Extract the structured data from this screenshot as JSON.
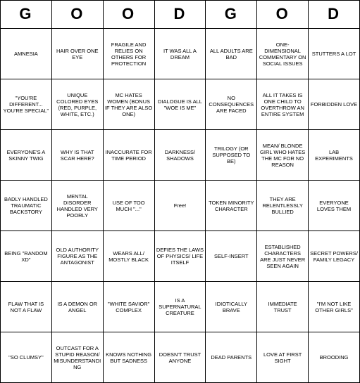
{
  "header": {
    "cols": [
      "G",
      "O",
      "O",
      "D",
      "G",
      "O",
      "D"
    ]
  },
  "rows": [
    [
      "AMNESIA",
      "HAIR OVER ONE EYE",
      "FRAGILE AND RELIES ON OTHERS FOR PROTECTION",
      "IT WAS ALL A DREAM",
      "ALL ADULTS ARE BAD",
      "ONE-DIMENSIONAL COMMENTARY ON SOCIAL ISSUES",
      "STUTTERS A LOT"
    ],
    [
      "\"YOU'RE DIFFERENT... YOU'RE SPECIAL\"",
      "UNIQUE COLORED EYES (RED, PURPLE, WHITE, ETC.)",
      "MC HATES WOMEN (BONUS IF THEY ARE ALSO ONE)",
      "DIALOGUE IS ALL \"WOE IS ME\"",
      "NO CONSEQUENCES ARE FACED",
      "ALL IT TAKES IS ONE CHILD TO OVERTHROW AN ENTIRE SYSTEM",
      "FORBIDDEN LOVE"
    ],
    [
      "EVERYONE'S A SKINNY TWIG",
      "WHY IS THAT SCAR HERE?",
      "INACCURATE FOR TIME PERIOD",
      "DARKNESS/ SHADOWS",
      "TRILOGY (OR SUPPOSED TO BE)",
      "MEAN/ BLONDE GIRL WHO HATES THE MC FOR NO REASON",
      "LAB EXPERIMENTS"
    ],
    [
      "BADLY HANDLED TRAUMATIC BACKSTORY",
      "MENTAL DISORDER HANDLED VERY POORLY",
      "USE OF TOO MUCH \"...\"",
      "Free!",
      "TOKEN MINORITY CHARACTER",
      "THEY ARE RELENTLESSLY BULLIED",
      "EVERYONE LOVES THEM"
    ],
    [
      "BEING \"RANDOM XD\"",
      "OLD AUTHORITY FIGURE AS THE ANTAGONIST",
      "WEARS ALL/ MOSTLY BLACK",
      "DEFIES THE LAWS OF PHYSICS/ LIFE ITSELF",
      "SELF-INSERT",
      "ESTABLISHED CHARACTERS ARE JUST NEVER SEEN AGAIN",
      "SECRET POWERS/ FAMILY LEGACY"
    ],
    [
      "FLAW THAT IS NOT A FLAW",
      "IS A DEMON OR ANGEL",
      "\"WHITE SAVIOR\" COMPLEX",
      "IS A SUPERNATURAL CREATURE",
      "IDIOTICALLY BRAVE",
      "IMMEDIATE TRUST",
      "\"I'M NOT LIKE OTHER GIRLS\""
    ],
    [
      "\"SO CLUMSY\"",
      "OUTCAST FOR A STUPID REASON/ MISUNDERSTANDING",
      "KNOWS NOTHING BUT SADNESS",
      "DOESN'T TRUST ANYONE",
      "DEAD PARENTS",
      "LOVE AT FIRST SIGHT",
      "BROODING"
    ]
  ]
}
